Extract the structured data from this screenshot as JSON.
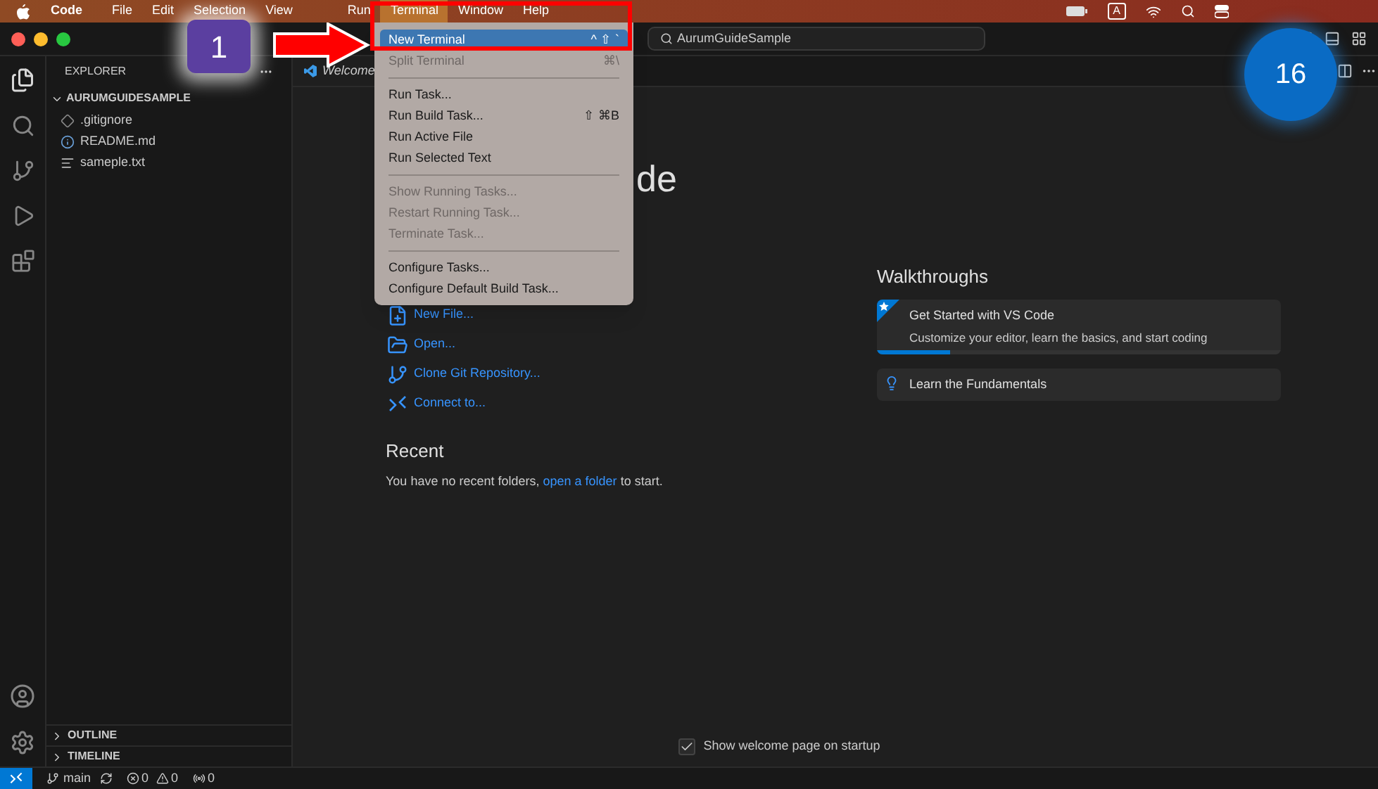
{
  "menubar": {
    "app": "Code",
    "items": [
      {
        "label": "File",
        "selected": false
      },
      {
        "label": "Edit",
        "selected": false
      },
      {
        "label": "Selection",
        "selected": false
      },
      {
        "label": "View",
        "selected": false
      },
      {
        "label": "Run",
        "selected": false
      },
      {
        "label": "Terminal",
        "selected": true
      },
      {
        "label": "Window",
        "selected": false
      },
      {
        "label": "Help",
        "selected": false
      }
    ],
    "input_badge": "A"
  },
  "window": {
    "search": "AurumGuideSample"
  },
  "sidebar": {
    "title": "EXPLORER",
    "folder": "AURUMGUIDESAMPLE",
    "files": [
      {
        "name": ".gitignore",
        "kind": "git"
      },
      {
        "name": "README.md",
        "kind": "info"
      },
      {
        "name": "sameple.txt",
        "kind": "text"
      }
    ],
    "sections": [
      "OUTLINE",
      "TIMELINE"
    ]
  },
  "tab": {
    "label": "Welcome"
  },
  "welcome": {
    "title_fragment": "de",
    "start": [
      {
        "label": "New File...",
        "kind": "new-file"
      },
      {
        "label": "Open...",
        "kind": "open"
      },
      {
        "label": "Clone Git Repository...",
        "kind": "clone"
      },
      {
        "label": "Connect to...",
        "kind": "remote"
      }
    ],
    "recent_title": "Recent",
    "recent_text": "You have no recent folders,",
    "recent_link": "open a folder",
    "recent_tail": "to start.",
    "walkthroughs_title": "Walkthroughs",
    "walkthroughs": [
      {
        "title": "Get Started with VS Code",
        "description": "Customize your editor, learn the basics, and start coding",
        "featured": true,
        "level": 0.18
      },
      {
        "title": "Learn the Fundamentals",
        "featured": false
      }
    ],
    "show_on_startup": {
      "label": "Show welcome page on startup",
      "checked": true
    }
  },
  "terminal_menu": [
    {
      "label": "New Terminal",
      "shortcut": "^ ⇧ `",
      "selected": true,
      "disabled": false
    },
    {
      "label": "Split Terminal",
      "shortcut": "⌘\\",
      "selected": false,
      "disabled": true
    },
    {
      "kind": "separator"
    },
    {
      "label": "Run Task...",
      "selected": false,
      "disabled": false
    },
    {
      "label": "Run Build Task...",
      "shortcut": "⇧ ⌘B",
      "selected": false,
      "disabled": false
    },
    {
      "label": "Run Active File",
      "selected": false,
      "disabled": false
    },
    {
      "label": "Run Selected Text",
      "selected": false,
      "disabled": false
    },
    {
      "kind": "separator"
    },
    {
      "label": "Show Running Tasks...",
      "selected": false,
      "disabled": true
    },
    {
      "label": "Restart Running Task...",
      "selected": false,
      "disabled": true
    },
    {
      "label": "Terminate Task...",
      "selected": false,
      "disabled": true
    },
    {
      "kind": "separator"
    },
    {
      "label": "Configure Tasks...",
      "selected": false,
      "disabled": false
    },
    {
      "label": "Configure Default Build Task...",
      "selected": false,
      "disabled": false
    }
  ],
  "status_bar": {
    "branch": "main",
    "errors": "0",
    "warnings": "0",
    "ports": "0"
  },
  "annotations": {
    "step": "1",
    "counter": "16"
  }
}
